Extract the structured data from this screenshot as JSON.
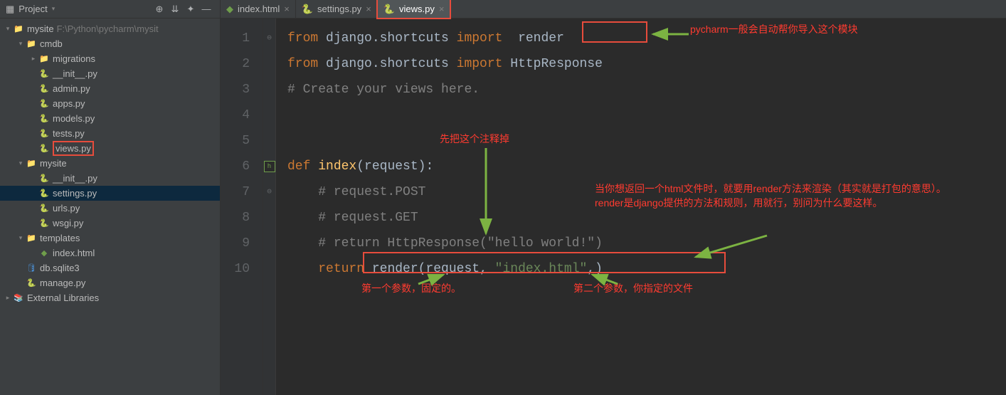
{
  "toolHeader": {
    "title": "Project"
  },
  "tree": {
    "root": {
      "name": "mysite",
      "path": " F:\\Python\\pycharm\\mysit"
    },
    "cmdb": {
      "name": "cmdb"
    },
    "migrations": {
      "name": "migrations"
    },
    "files1": [
      "__init__.py",
      "admin.py",
      "apps.py",
      "models.py",
      "tests.py",
      "views.py"
    ],
    "mysite2": {
      "name": "mysite"
    },
    "files2": [
      "__init__.py",
      "settings.py",
      "urls.py",
      "wsgi.py"
    ],
    "templates": {
      "name": "templates"
    },
    "indexhtml": "index.html",
    "dbsqlite": "db.sqlite3",
    "managepy": "manage.py",
    "extlib": "External Libraries"
  },
  "tabs": [
    {
      "label": "index.html",
      "icon": "html"
    },
    {
      "label": "settings.py",
      "icon": "py"
    },
    {
      "label": "views.py",
      "icon": "py",
      "active": true
    }
  ],
  "lineNumbers": [
    "1",
    "2",
    "3",
    "4",
    "5",
    "6",
    "7",
    "8",
    "9",
    "10"
  ],
  "code": {
    "l1a": "from ",
    "l1b": "django.shortcuts ",
    "l1c": "import ",
    "l1d": " render",
    "l2a": "from ",
    "l2b": "django.shortcuts ",
    "l2c": "import ",
    "l2d": "HttpResponse",
    "l3": "# Create your views here.",
    "l6a": "def ",
    "l6b": "index",
    "l6c": "(request):",
    "l7": "# request.POST",
    "l8": "# request.GET",
    "l9": "# return HttpResponse(\"hello world!\")",
    "l10a": "return ",
    "l10b": "render(request, ",
    "l10c": "\"index.html\"",
    "l10d": ",)"
  },
  "annotations": {
    "a1": "pycharm一般会自动帮你导入这个模块",
    "a2": "先把这个注释掉",
    "a3": "当你想返回一个html文件时，就要用render方法来渲染（其实就是打包的意思）。\nrender是django提供的方法和规则，用就行，别问为什么要这样。",
    "a4": "第一个参数，固定的。",
    "a5": "第二个参数，你指定的文件"
  }
}
